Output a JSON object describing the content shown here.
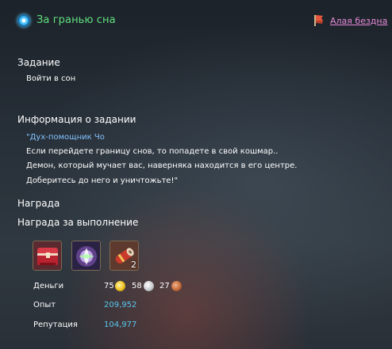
{
  "header": {
    "title": "За гранью сна",
    "quest_icon": "quest-orb-icon",
    "region_icon": "region-flag-icon",
    "region_link": "Алая бездна"
  },
  "task": {
    "heading": "Задание",
    "objective": "Войти в сон"
  },
  "info": {
    "heading": "Информация о задании",
    "speaker": "\"Дух-помощник Чо",
    "lines": [
      "Если перейдете границу снов, то попадете в свой кошмар..",
      "Демон, который мучает вас, наверняка находится в его центре.",
      "Доберитесь до него и уничтожьте!\""
    ]
  },
  "reward": {
    "heading": "Награда",
    "completion_heading": "Награда за выполнение",
    "items": [
      {
        "icon": "red-treasure-chest-icon",
        "count": ""
      },
      {
        "icon": "glowing-crystal-icon",
        "count": ""
      },
      {
        "icon": "scroll-bundle-icon",
        "count": "2"
      }
    ],
    "money_label": "Деньги",
    "money": {
      "gold": "75",
      "gold_icon": "gold-coin-icon",
      "silver": "58",
      "silver_icon": "silver-coin-icon",
      "copper": "27",
      "copper_icon": "copper-coin-icon"
    },
    "exp_label": "Опыт",
    "exp_value": "209,952",
    "rep_label": "Репутация",
    "rep_value": "104,977"
  },
  "colors": {
    "title_green": "#5fe07f",
    "link_pink": "#e58ad8",
    "value_blue": "#59c8f0",
    "speaker_blue": "#84c4ff"
  }
}
